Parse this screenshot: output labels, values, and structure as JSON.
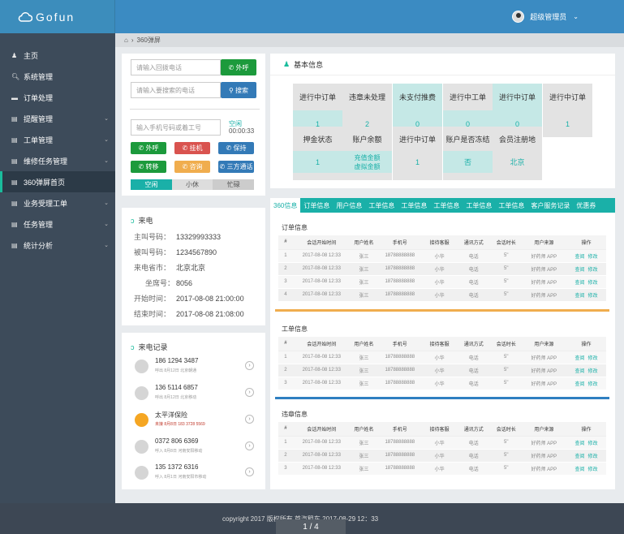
{
  "app": {
    "logo": "Gofun",
    "user": "超级管理员"
  },
  "breadcrumb": {
    "current": "360弹屏"
  },
  "sidebar": {
    "items": [
      {
        "label": "主页"
      },
      {
        "label": "系统管理"
      },
      {
        "label": "订单处理"
      },
      {
        "label": "提醒管理"
      },
      {
        "label": "工单管理"
      },
      {
        "label": "维修任务管理"
      },
      {
        "label": "360弹屏首页"
      },
      {
        "label": "业务受理工单"
      },
      {
        "label": "任务管理"
      },
      {
        "label": "统计分析"
      }
    ]
  },
  "call": {
    "callback_placeholder": "请输入回拨电话",
    "outbound_btn": "外呼",
    "search_placeholder": "请输入要搜索的电话",
    "search_btn": "搜索",
    "dial_placeholder": "输入手机号码或着工号",
    "status": "空闲",
    "timer": "00:00:33",
    "btns": [
      "外呼",
      "挂机",
      "保持",
      "转移",
      "咨询",
      "三方通话"
    ],
    "states": [
      "空闲",
      "小休",
      "忙碌"
    ]
  },
  "incoming": {
    "title": "来电",
    "rows": [
      {
        "label": "主叫号码：",
        "value": "13329993333"
      },
      {
        "label": "被叫号码：",
        "value": "1234567890"
      },
      {
        "label": "来电省市：",
        "value": "北京北京"
      },
      {
        "label": "坐席号：",
        "value": "8056"
      },
      {
        "label": "开始时间：",
        "value": "2017-08-08  21:00:00"
      },
      {
        "label": "结束时间：",
        "value": "2017-08-08  21:08:00"
      }
    ]
  },
  "records": {
    "title": "来电记录",
    "items": [
      {
        "num": "186 1294 3487",
        "sub": "呼出   8月12日   北京朝通"
      },
      {
        "num": "136 5114 6857",
        "sub": "呼出   8月12日   北京移动"
      },
      {
        "num": "太平洋保险",
        "sub": "未接   8月8日   183 3728 5569"
      },
      {
        "num": "0372 806 6369",
        "sub": "呼入   8月8日   河南安阳移动"
      },
      {
        "num": "135 1372 6316",
        "sub": "呼入   8月1日   河南安阳市移动"
      }
    ]
  },
  "basic": {
    "title": "基本信息",
    "row1": [
      {
        "h": "进行中订单",
        "v": "1"
      },
      {
        "h": "违章未处理",
        "v": "2"
      },
      {
        "h": "未支付推费",
        "v": "0"
      },
      {
        "h": "进行中工单",
        "v": "0"
      },
      {
        "h": "进行中订单",
        "v": "0"
      },
      {
        "h": "进行中订单",
        "v": "1"
      }
    ],
    "row2": [
      {
        "h": "押金状态",
        "v": "1"
      },
      {
        "h": "账户余额",
        "v": "充值金额"
      },
      {
        "h": "进行中订单",
        "v": "1"
      },
      {
        "h": "账户是否冻结",
        "v": "否"
      },
      {
        "h": "会员注册地",
        "v": "北京"
      }
    ],
    "balance_sub": "虚拟金额"
  },
  "tabs": [
    "360信息",
    "订单信息",
    "用户信息",
    "工单信息",
    "工单信息",
    "工单信息",
    "工单信息",
    "工单信息",
    "客户服务记录",
    "优惠券"
  ],
  "tables": {
    "headers": [
      "#",
      "会话开始时间",
      "用户姓名",
      "手机号",
      "接待客服",
      "通讯方式",
      "会话时长",
      "用户来源",
      "操作"
    ],
    "view": "查阅",
    "edit": "修改",
    "sections": [
      {
        "title": "订单信息",
        "rows": [
          [
            "1",
            "2017-08-08  12:33",
            "张三",
            "18788888888",
            "小华",
            "电话",
            "5\"",
            "好药师 APP"
          ],
          [
            "2",
            "2017-08-08  12:33",
            "张三",
            "18788888888",
            "小华",
            "电话",
            "5\"",
            "好药师 APP"
          ],
          [
            "3",
            "2017-08-08  12:33",
            "张三",
            "18788888888",
            "小华",
            "电话",
            "5\"",
            "好药师 APP"
          ],
          [
            "4",
            "2017-08-08  12:33",
            "张三",
            "18788888888",
            "小华",
            "电话",
            "5\"",
            "好药师 APP"
          ]
        ]
      },
      {
        "title": "工单信息",
        "rows": [
          [
            "1",
            "2017-08-08  12:33",
            "张三",
            "18788888888",
            "小华",
            "电话",
            "5\"",
            "好药师 APP"
          ],
          [
            "2",
            "2017-08-08  12:33",
            "张三",
            "18788888888",
            "小华",
            "电话",
            "5\"",
            "好药师 APP"
          ],
          [
            "3",
            "2017-08-08  12:33",
            "张三",
            "18788888888",
            "小华",
            "电话",
            "5\"",
            "好药师 APP"
          ]
        ]
      },
      {
        "title": "违章信息",
        "rows": [
          [
            "1",
            "2017-08-08  12:33",
            "张三",
            "18788888888",
            "小华",
            "电话",
            "5\"",
            "好药师 APP"
          ],
          [
            "2",
            "2017-08-08  12:33",
            "张三",
            "18788888888",
            "小华",
            "电话",
            "5\"",
            "好药师 APP"
          ],
          [
            "3",
            "2017-08-08  12:33",
            "张三",
            "18788888888",
            "小华",
            "电话",
            "5\"",
            "好药师 APP"
          ]
        ]
      }
    ]
  },
  "footer": {
    "copyright": "copyright  2017  版权所有  首汽租车      2017-08-29  12：33",
    "page": "1 / 4"
  },
  "colors": {
    "header": "#3b8bc2",
    "sidebar": "#3d4b5a",
    "accent": "#1ab0a8",
    "green": "#1c9a3c",
    "red": "#d9534f",
    "orange": "#f0ad4e",
    "blue": "#337ab7"
  }
}
